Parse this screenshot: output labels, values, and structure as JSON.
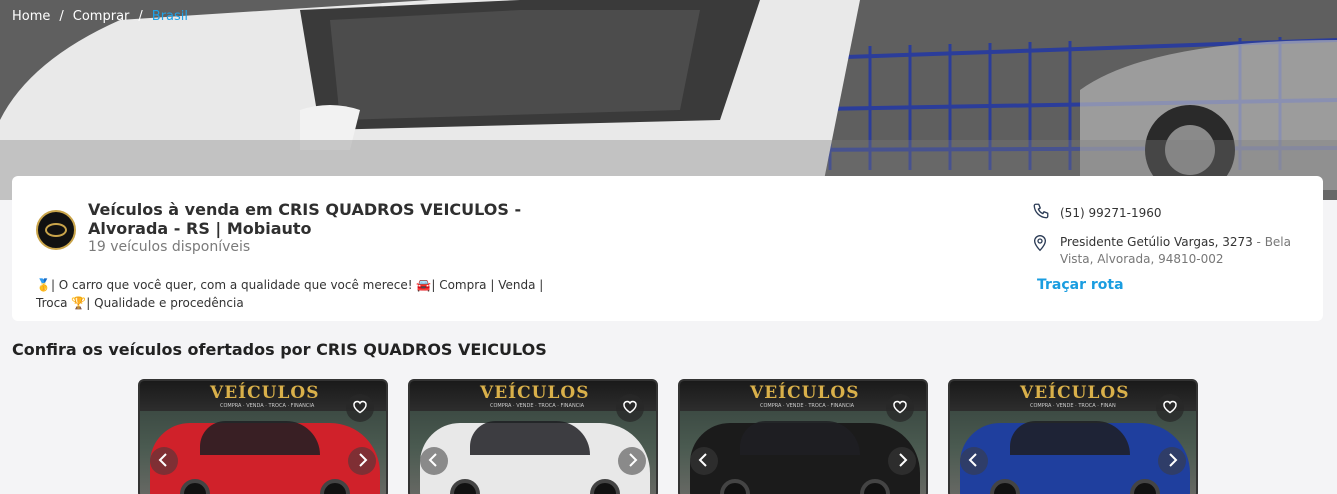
{
  "breadcrumb": {
    "items": [
      "Home",
      "Comprar"
    ],
    "current": "Brasil",
    "separator": "/"
  },
  "store": {
    "title": "Veículos à venda em CRIS QUADROS VEICULOS - Alvorada - RS | Mobiauto",
    "count": "19 veículos disponíveis",
    "description": "🥇| O carro que você quer, com a qualidade que você merece! 🚘| Compra | Venda | Troca 🏆| Qualidade e procedência",
    "phone": "(51) 99271-1960",
    "address_main": "Presidente Getúlio Vargas, 3273",
    "address_rest": " - Bela Vista, Alvorada, 94810-002",
    "route_label": "Traçar rota"
  },
  "section": {
    "title": "Confira os veículos ofertados por CRIS QUADROS VEICULOS"
  },
  "vehicles": [
    {
      "sign": "VEÍCULOS",
      "sub": "COMPRA · VENDA · TROCA · FINANCIA",
      "color": "#d0212a"
    },
    {
      "sign": "VEÍCULOS",
      "sub": "COMPRA · VENDE · TROCA · FINANCIA",
      "color": "#e8e8e8"
    },
    {
      "sign": "VEÍCULOS",
      "sub": "COMPRA · VENDE · TROCA · FINANCIA",
      "color": "#1b1b1b"
    },
    {
      "sign": "VEÍCULOS",
      "sub": "COMPRA · VENDE · TROCA · FINAN",
      "color": "#1f3f9e"
    }
  ],
  "icons": {
    "phone": "phone-icon",
    "location": "map-pin-icon",
    "favorite": "heart-icon",
    "prev": "chevron-left-icon",
    "next": "chevron-right-icon"
  },
  "colors": {
    "accent": "#1a9de0",
    "breadcrumb_current": "#1da1e8"
  }
}
